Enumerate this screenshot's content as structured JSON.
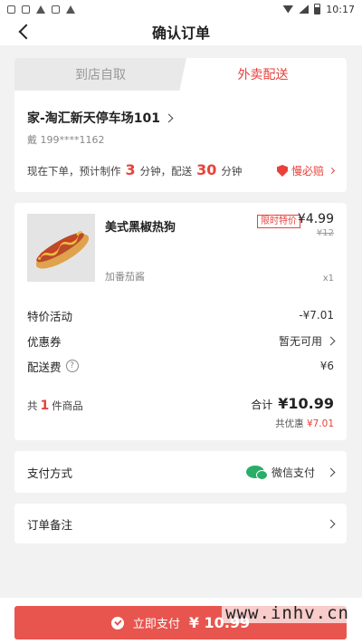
{
  "status_bar": {
    "time": "10:17"
  },
  "nav": {
    "title": "确认订单"
  },
  "tabs": {
    "pickup": "到店自取",
    "delivery": "外卖配送"
  },
  "address": {
    "line": "家-淘汇新天停车场101",
    "phone": "戴 199****1162",
    "eta_prefix": "现在下单，预计制作",
    "make_minutes": "3",
    "eta_mid": "分钟，配送",
    "delivery_minutes": "30",
    "eta_suffix": "分钟",
    "late_label": "慢必赔"
  },
  "product": {
    "name": "美式黑椒热狗",
    "option": "加番茄酱",
    "badge": "限时特价",
    "price": "¥4.99",
    "original_price": "¥12",
    "quantity": "x1"
  },
  "fees": [
    {
      "label": "特价活动",
      "value": "-¥7.01"
    },
    {
      "label": "优惠券",
      "value": "暂无可用"
    },
    {
      "label": "配送费",
      "value": "¥6"
    }
  ],
  "summary": {
    "count_prefix": "共",
    "count": "1",
    "count_suffix": "件商品",
    "total_label": "合计",
    "total": "¥10.99",
    "discount_label": "共优惠",
    "discount": "¥7.01"
  },
  "payment": {
    "label": "支付方式",
    "method": "微信支付"
  },
  "note": {
    "label": "订单备注"
  },
  "pay_button": {
    "label": "立即支付",
    "amount": "¥ 10.99"
  },
  "watermark": "www.inhv.cn",
  "colors": {
    "accent": "#e8413b",
    "button": "#e8554e",
    "wechat": "#2aae67"
  }
}
